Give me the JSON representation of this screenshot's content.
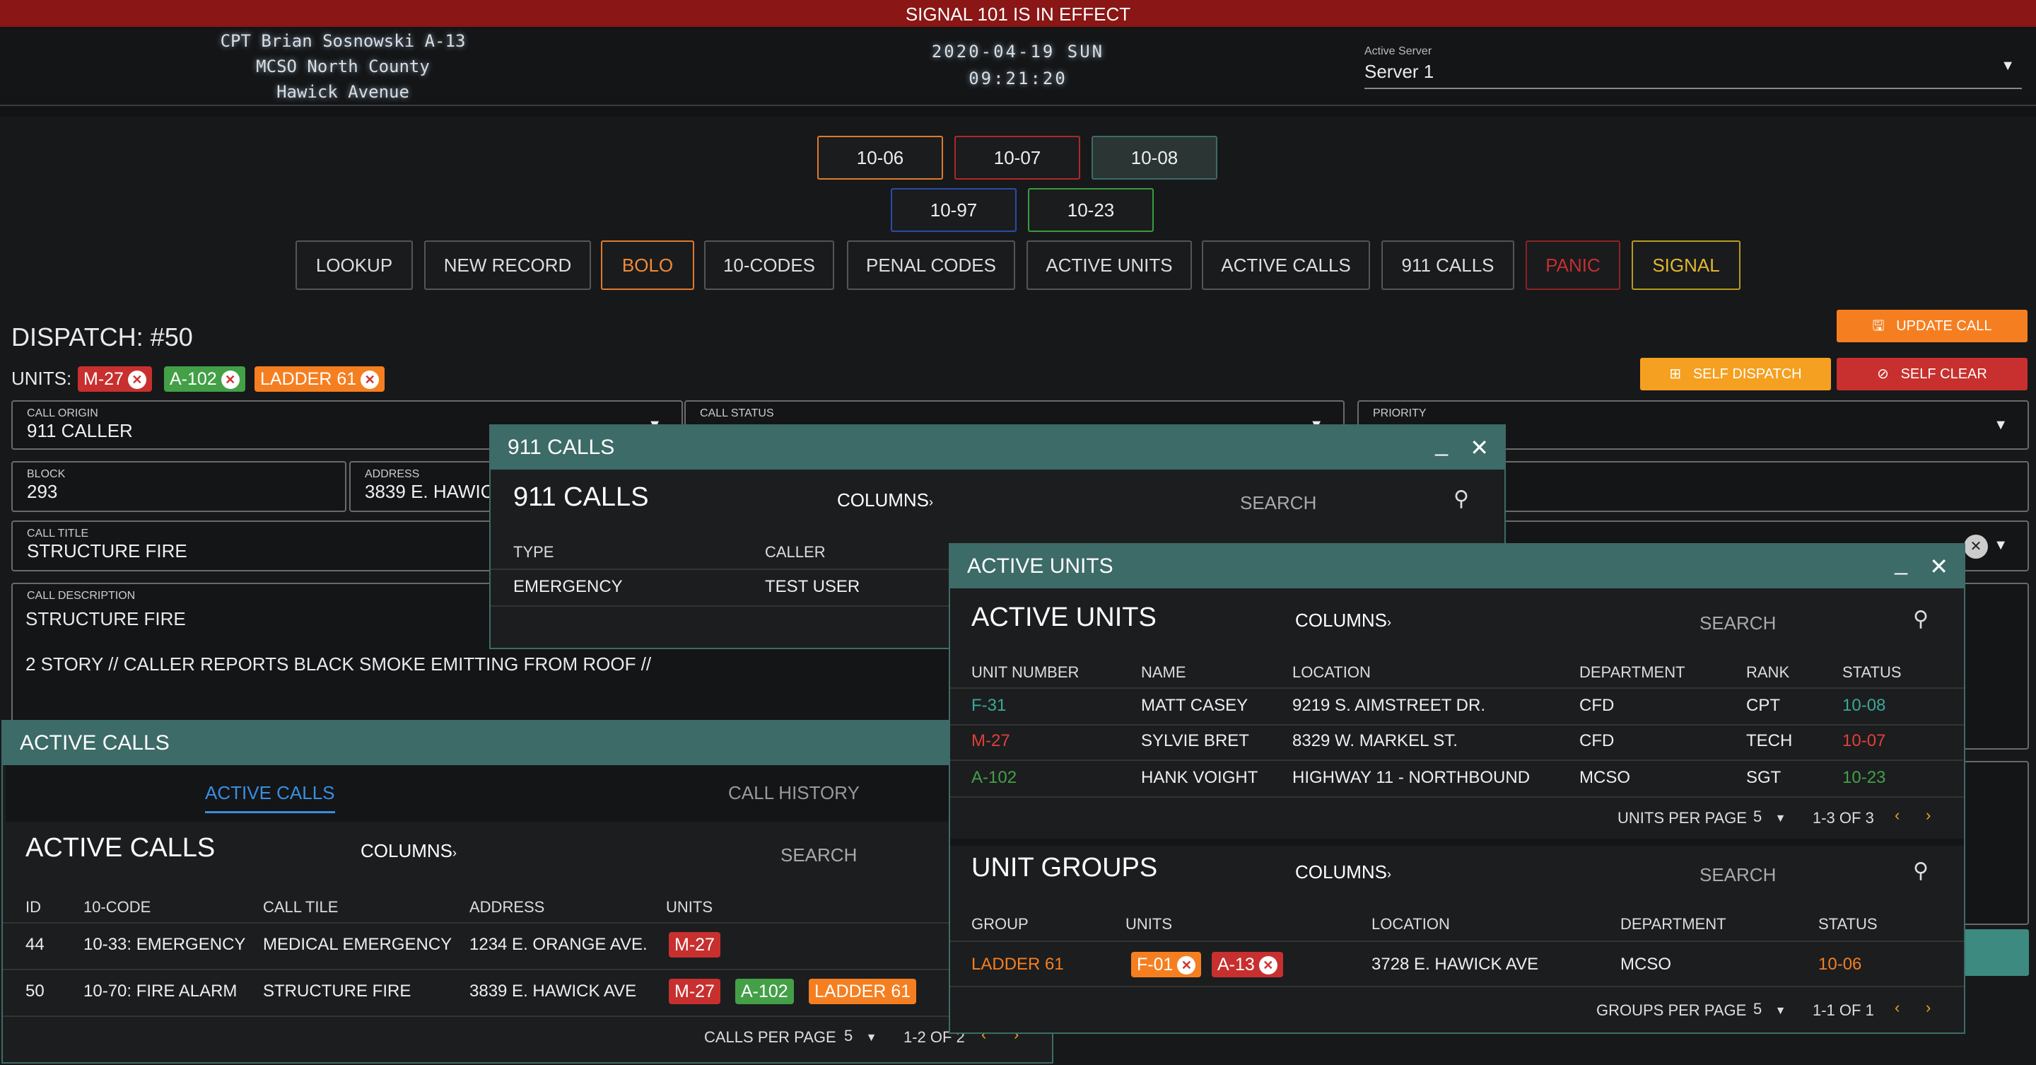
{
  "signal_banner": "SIGNAL 101 IS IN EFFECT",
  "header": {
    "user": "CPT Brian Sosnowski A-13",
    "agency": "MCSO North County",
    "location": "Hawick Avenue",
    "date": "2020-04-19 SUN",
    "time": "09:21:20",
    "server_label": "Active Server",
    "server_value": "Server 1"
  },
  "status_codes": [
    "10-06",
    "10-07",
    "10-08",
    "10-97",
    "10-23"
  ],
  "nav": [
    "LOOKUP",
    "NEW RECORD",
    "BOLO",
    "10-CODES",
    "PENAL CODES",
    "ACTIVE UNITS",
    "ACTIVE CALLS",
    "911 CALLS",
    "PANIC",
    "SIGNAL"
  ],
  "dispatch": {
    "title": "DISPATCH: #50",
    "units_label": "UNITS:",
    "units": [
      "M-27",
      "A-102",
      "LADDER 61"
    ],
    "update_btn": "UPDATE CALL",
    "self_dispatch_btn": "SELF DISPATCH",
    "self_clear_btn": "SELF CLEAR",
    "fields": {
      "call_origin_label": "CALL ORIGIN",
      "call_origin": "911 CALLER",
      "call_status_label": "CALL STATUS",
      "priority_label": "PRIORITY",
      "block_label": "BLOCK",
      "block": "293",
      "address_label": "ADDRESS",
      "address": "3839 E. HAWIC",
      "call_title_label": "CALL TITLE",
      "call_title": "STRUCTURE FIRE",
      "desc_label": "CALL DESCRIPTION",
      "desc_line1": "STRUCTURE FIRE",
      "desc_line2": "2 STORY // CALLER REPORTS BLACK SMOKE EMITTING FROM ROOF //"
    }
  },
  "calls911": {
    "window_title": "911 CALLS",
    "title": "911 CALLS",
    "columns": "COLUMNS",
    "search": "SEARCH",
    "headers": [
      "TYPE",
      "CALLER"
    ],
    "rows": [
      [
        "EMERGENCY",
        "TEST USER"
      ]
    ]
  },
  "active_units": {
    "window_title": "ACTIVE UNITS",
    "title": "ACTIVE UNITS",
    "columns": "COLUMNS",
    "search": "SEARCH",
    "headers": [
      "UNIT NUMBER",
      "NAME",
      "LOCATION",
      "DEPARTMENT",
      "RANK",
      "STATUS"
    ],
    "rows": [
      [
        "F-31",
        "MATT CASEY",
        "9219 S. AIMSTREET DR.",
        "CFD",
        "CPT",
        "10-08"
      ],
      [
        "M-27",
        "SYLVIE BRET",
        "8329 W. MARKEL ST.",
        "CFD",
        "TECH",
        "10-07"
      ],
      [
        "A-102",
        "HANK VOIGHT",
        "HIGHWAY 11 - NORTHBOUND",
        "MCSO",
        "SGT",
        "10-23"
      ]
    ],
    "per_page_label": "UNITS PER PAGE",
    "per_page": "5",
    "range": "1-3 OF 3",
    "groups_title": "UNIT GROUPS",
    "groups_columns": "COLUMNS",
    "groups_search": "SEARCH",
    "group_headers": [
      "GROUP",
      "UNITS",
      "LOCATION",
      "DEPARTMENT",
      "STATUS"
    ],
    "group_row": {
      "group": "LADDER 61",
      "units": [
        "F-01",
        "A-13"
      ],
      "location": "3728 E. HAWICK AVE",
      "department": "MCSO",
      "status": "10-06"
    },
    "groups_per_page_label": "GROUPS PER PAGE",
    "groups_per_page": "5",
    "groups_range": "1-1 OF 1"
  },
  "active_calls": {
    "window_title": "ACTIVE CALLS",
    "tabs": [
      "ACTIVE CALLS",
      "CALL HISTORY"
    ],
    "title": "ACTIVE CALLS",
    "columns": "COLUMNS",
    "search": "SEARCH",
    "headers": [
      "ID",
      "10-CODE",
      "CALL TILE",
      "ADDRESS",
      "UNITS"
    ],
    "rows": [
      {
        "id": "44",
        "code": "10-33: EMERGENCY",
        "title": "MEDICAL EMERGENCY",
        "address": "1234 E. ORANGE AVE.",
        "units": [
          "M-27"
        ]
      },
      {
        "id": "50",
        "code": "10-70: FIRE ALARM",
        "title": "STRUCTURE FIRE",
        "address": "3839 E. HAWICK AVE",
        "units": [
          "M-27",
          "A-102",
          "LADDER 61"
        ]
      }
    ],
    "per_page_label": "CALLS PER PAGE",
    "per_page": "5",
    "range": "1-2 OF 2"
  },
  "colors": {
    "teal": "#3d6b67",
    "green_status": "#43a047",
    "red_status": "#e0403a",
    "orange_status": "#f57f20"
  }
}
